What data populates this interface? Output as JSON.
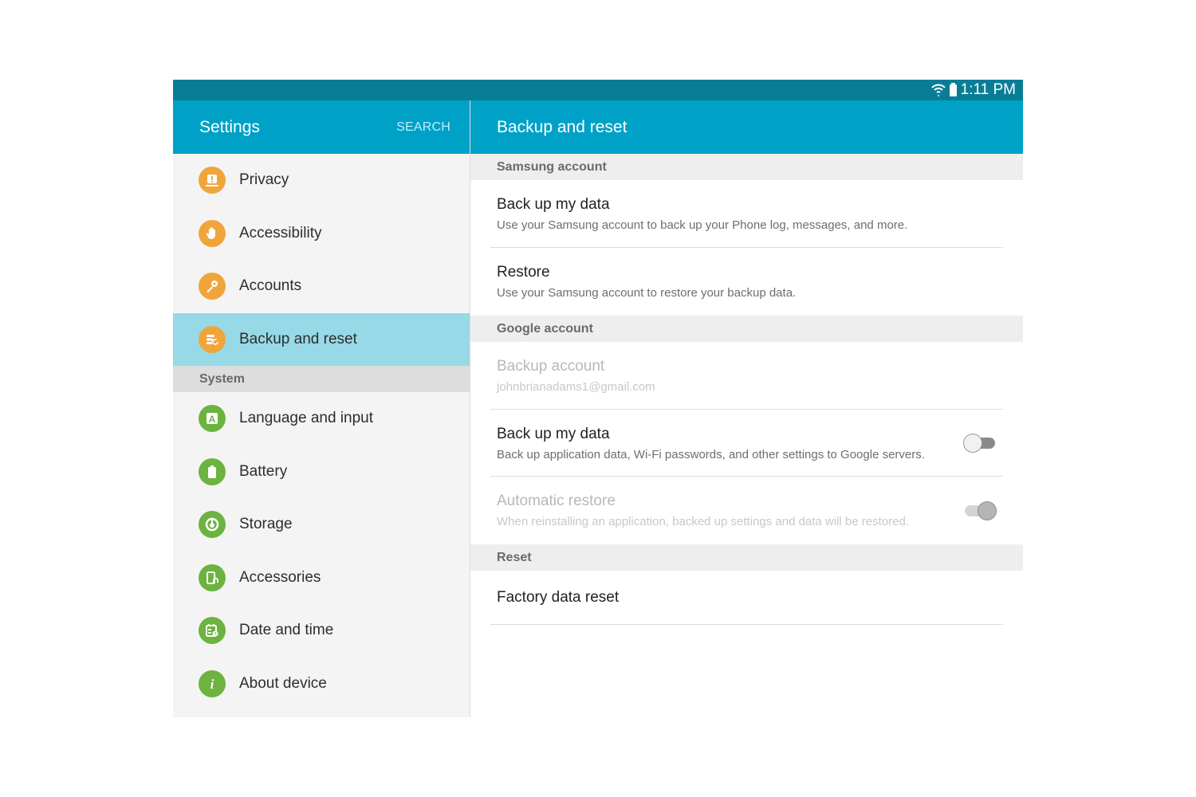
{
  "status_bar": {
    "wifi_icon": "wifi-icon",
    "battery_icon": "battery-icon",
    "time": "1:11 PM"
  },
  "left_panel": {
    "title": "Settings",
    "search_label": "SEARCH",
    "items_top": [
      {
        "label": "Privacy",
        "icon": "privacy-icon",
        "color": "#f0a53a"
      },
      {
        "label": "Accessibility",
        "icon": "hand-icon",
        "color": "#f0a53a"
      },
      {
        "label": "Accounts",
        "icon": "key-icon",
        "color": "#f0a53a"
      },
      {
        "label": "Backup and reset",
        "icon": "backup-icon",
        "color": "#f0a53a",
        "selected": true
      }
    ],
    "section_label": "System",
    "items_system": [
      {
        "label": "Language and input",
        "icon": "language-icon",
        "color": "#6cb33f"
      },
      {
        "label": "Battery",
        "icon": "battery-icon",
        "color": "#6cb33f"
      },
      {
        "label": "Storage",
        "icon": "storage-icon",
        "color": "#6cb33f"
      },
      {
        "label": "Accessories",
        "icon": "accessories-icon",
        "color": "#6cb33f"
      },
      {
        "label": "Date and time",
        "icon": "calendar-clock-icon",
        "color": "#6cb33f"
      },
      {
        "label": "About device",
        "icon": "info-icon",
        "color": "#6cb33f"
      }
    ]
  },
  "right_panel": {
    "title": "Backup and reset",
    "samsung_section": {
      "label": "Samsung account",
      "backup": {
        "title": "Back up my data",
        "summary": "Use your Samsung account to back up your Phone log, messages, and more."
      },
      "restore": {
        "title": "Restore",
        "summary": "Use your Samsung account to restore your backup data."
      }
    },
    "google_section": {
      "label": "Google account",
      "backup_account": {
        "title": "Backup account",
        "summary": "johnbrianadams1@gmail.com",
        "enabled": false
      },
      "backup_data": {
        "title": "Back up my data",
        "summary": "Back up application data, Wi-Fi passwords, and other settings to Google servers.",
        "toggle": "off"
      },
      "auto_restore": {
        "title": "Automatic restore",
        "summary": "When reinstalling an application, backed up settings and data will be restored.",
        "toggle": "on",
        "enabled": false
      }
    },
    "reset_section": {
      "label": "Reset",
      "factory_reset": {
        "title": "Factory data reset"
      }
    }
  },
  "colors": {
    "accent": "#00a1c7",
    "status_bar": "#0a7d96",
    "selected_item": "#97d9e6",
    "orange_icon": "#f0a53a",
    "green_icon": "#6cb33f"
  }
}
